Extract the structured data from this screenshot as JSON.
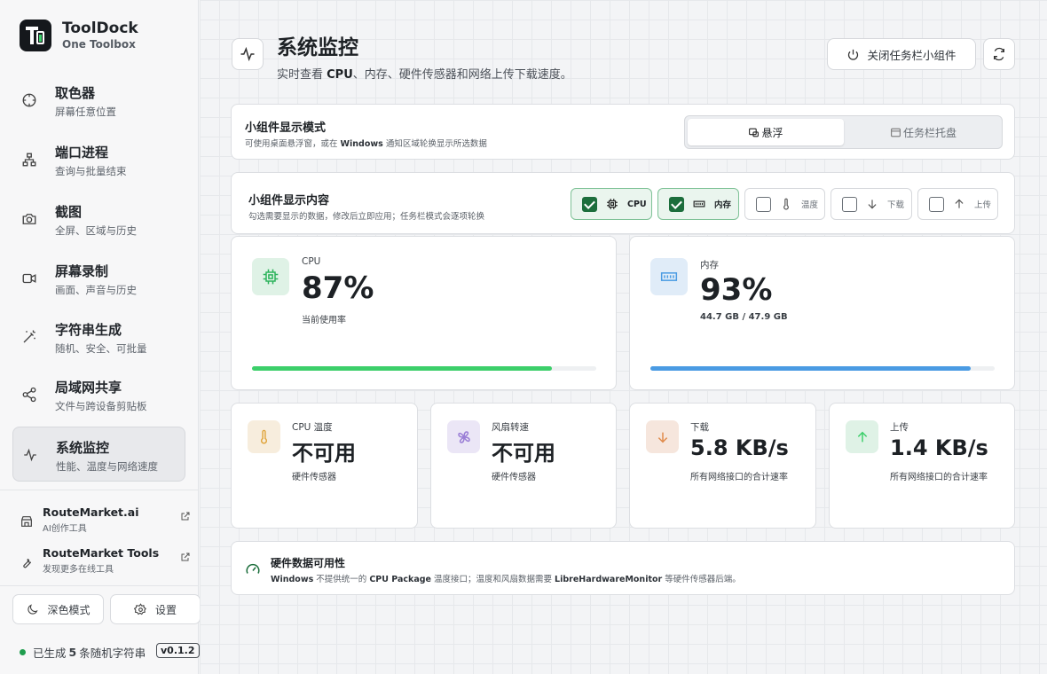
{
  "brand": {
    "name": "ToolDock",
    "subtitle": "One Toolbox"
  },
  "sidebar": {
    "items": [
      {
        "title": "取色器",
        "subtitle": "屏幕任意位置",
        "icon": "crosshair-icon"
      },
      {
        "title": "端口进程",
        "subtitle": "查询与批量结束",
        "icon": "network-icon"
      },
      {
        "title": "截图",
        "subtitle": "全屏、区域与历史",
        "icon": "camera-icon"
      },
      {
        "title": "屏幕录制",
        "subtitle": "画面、声音与历史",
        "icon": "video-icon"
      },
      {
        "title": "字符串生成",
        "subtitle": "随机、安全、可批量",
        "icon": "magic-wand-icon"
      },
      {
        "title": "局域网共享",
        "subtitle": "文件与跨设备剪贴板",
        "icon": "share-icon"
      },
      {
        "title": "系统监控",
        "subtitle": "性能、温度与网络速度",
        "icon": "activity-icon",
        "active": true
      }
    ],
    "links": [
      {
        "title": "RouteMarket.ai",
        "subtitle": "AI创作工具",
        "icon": "store-icon"
      },
      {
        "title": "RouteMarket Tools",
        "subtitle": "发现更多在线工具",
        "icon": "wrench-icon"
      }
    ],
    "dark_mode_label": "深色模式",
    "settings_label": "设置",
    "status": {
      "prefix": "已生成",
      "count": "5",
      "suffix": "条随机字符串"
    },
    "version": "v0.1.2"
  },
  "header": {
    "title": "系统监控",
    "subtitle_parts": [
      "实时查看 ",
      "CPU",
      "、内存、硬件传感器和网络上传下载速度。"
    ],
    "close_widget_label": "关闭任务栏小组件"
  },
  "mode_card": {
    "title": "小组件显示模式",
    "desc_parts": [
      "可使用桌面悬浮窗，或在 ",
      "Windows",
      " 通知区域轮换显示所选数据"
    ],
    "options": [
      {
        "label": "悬浮",
        "selected": true
      },
      {
        "label": "任务栏托盘",
        "selected": false
      }
    ]
  },
  "content_card": {
    "title": "小组件显示内容",
    "desc": "勾选需要显示的数据，修改后立即应用；任务栏模式会逐项轮换",
    "options": [
      {
        "label": "CPU",
        "checked": true,
        "icon": "cpu-icon"
      },
      {
        "label": "内存",
        "checked": true,
        "icon": "memory-icon"
      },
      {
        "label": "温度",
        "checked": false,
        "icon": "thermometer-icon"
      },
      {
        "label": "下载",
        "checked": false,
        "icon": "arrow-down-icon"
      },
      {
        "label": "上传",
        "checked": false,
        "icon": "arrow-up-icon"
      }
    ]
  },
  "stats": {
    "cpu": {
      "label": "CPU",
      "value": "87%",
      "note": "当前使用率",
      "usage": 0.87,
      "color": "#3ccf6a"
    },
    "memory": {
      "label": "内存",
      "value": "93%",
      "note": "44.7 GB / 47.9 GB",
      "usage": 0.93,
      "color": "#4a9be3"
    },
    "cpu_temp": {
      "label": "CPU 温度",
      "value": "不可用",
      "note": "硬件传感器"
    },
    "fan": {
      "label": "风扇转速",
      "value": "不可用",
      "note": "硬件传感器"
    },
    "download": {
      "label": "下载",
      "value": "5.8 KB/s",
      "note": "所有网络接口的合计速率"
    },
    "upload": {
      "label": "上传",
      "value": "1.4 KB/s",
      "note": "所有网络接口的合计速率"
    }
  },
  "availability": {
    "title": "硬件数据可用性",
    "desc_parts": [
      "Windows",
      " 不提供统一的 ",
      "CPU Package",
      " 温度接口；温度和风扇数据需要 ",
      "LibreHardwareMonitor",
      " 等硬件传感器后端。"
    ]
  }
}
